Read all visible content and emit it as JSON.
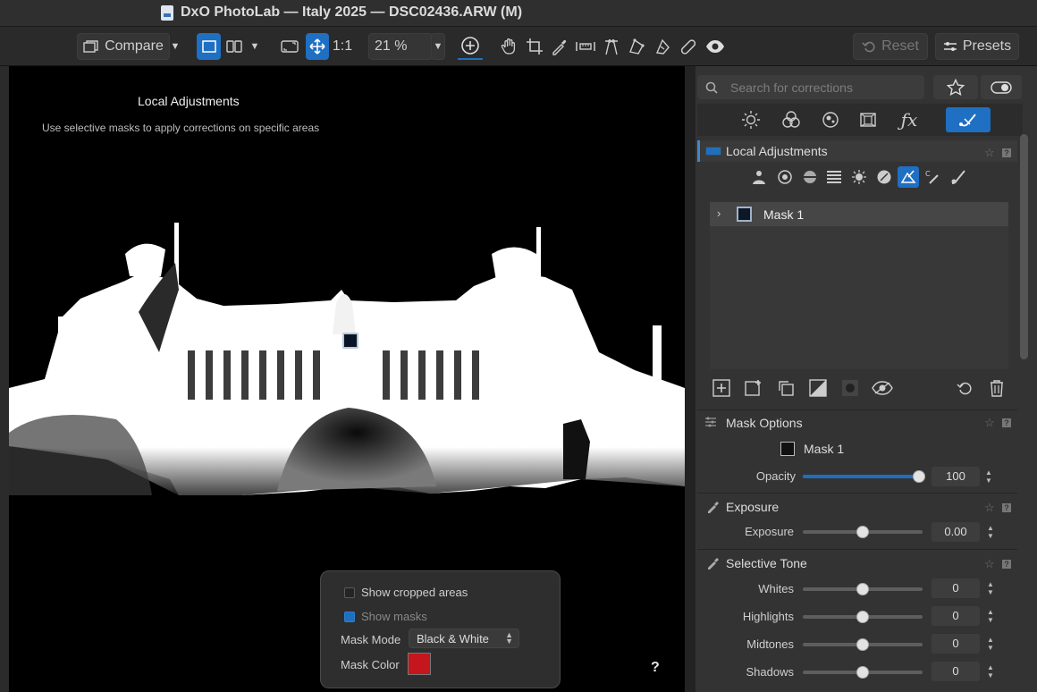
{
  "window": {
    "title": "DxO PhotoLab — Italy 2025 — DSC02436.ARW (M)"
  },
  "toolbar": {
    "compare_label": "Compare",
    "zoom_one_label": "1:1",
    "zoom_value": "21 %",
    "reset_label": "Reset",
    "presets_label": "Presets",
    "icons": [
      "single-view-icon",
      "split-view-icon",
      "fit-icon",
      "move-icon",
      "zoom-icon",
      "hand-icon",
      "crop-icon",
      "eyedropper-icon",
      "straighten-icon",
      "perspective-icon",
      "rotate-icon",
      "repair-icon",
      "bandage-icon",
      "eye-icon"
    ]
  },
  "viewer": {
    "heading": "Local Adjustments",
    "subheading": "Use selective masks to apply corrections on specific areas",
    "help_label": "?"
  },
  "popup": {
    "show_cropped_label": "Show cropped areas",
    "show_cropped_checked": false,
    "show_masks_label": "Show masks",
    "show_masks_checked": true,
    "mask_mode_label": "Mask Mode",
    "mask_mode_value": "Black & White",
    "mask_color_label": "Mask Color",
    "mask_color": "#c4161c"
  },
  "panel": {
    "search_placeholder": "Search for corrections",
    "palette_tabs": [
      "light-icon",
      "color-icon",
      "detail-icon",
      "geometry-icon",
      "effects-icon",
      "local-adjustments-icon"
    ],
    "local_adjustments": {
      "title": "Local Adjustments",
      "mask_name": "Mask 1"
    },
    "mask_options": {
      "title": "Mask Options",
      "mask_name": "Mask 1",
      "opacity_label": "Opacity",
      "opacity_value": "100",
      "opacity_fraction": 1.0
    },
    "exposure": {
      "title": "Exposure",
      "label": "Exposure",
      "value": "0.00",
      "fraction": 0.5
    },
    "selective_tone": {
      "title": "Selective Tone",
      "sliders": [
        {
          "label": "Whites",
          "value": "0",
          "fraction": 0.5
        },
        {
          "label": "Highlights",
          "value": "0",
          "fraction": 0.5
        },
        {
          "label": "Midtones",
          "value": "0",
          "fraction": 0.5
        },
        {
          "label": "Shadows",
          "value": "0",
          "fraction": 0.5
        }
      ]
    }
  },
  "colors": {
    "accent": "#1f6fc2",
    "panel": "#333333",
    "mask_color": "#c4161c"
  }
}
